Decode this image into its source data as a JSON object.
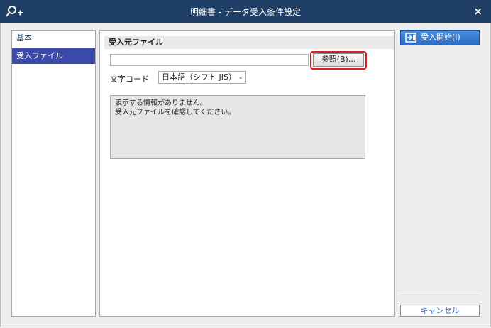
{
  "window": {
    "title": "明細書 - データ受入条件設定",
    "close_label": "×"
  },
  "sidebar": {
    "items": [
      {
        "label": "基本"
      },
      {
        "label": "受入ファイル"
      }
    ]
  },
  "main": {
    "section_title": "受入元ファイル",
    "file_input": {
      "value": "",
      "placeholder": ""
    },
    "browse_label": "参照(B)...",
    "charcode_label": "文字コード",
    "charcode_value": "日本語（シフト JIS）",
    "info_lines": [
      "表示する情報がありません。",
      "受入元ファイルを確認してください。"
    ]
  },
  "actions": {
    "start_label": "受入開始(I)",
    "cancel_label": "キャンセル"
  },
  "colors": {
    "titlebar": "#1f3f66",
    "sidebar_active": "#3b4aa8",
    "primary_button": "#2a6cc3",
    "highlight": "#e01b1b"
  }
}
